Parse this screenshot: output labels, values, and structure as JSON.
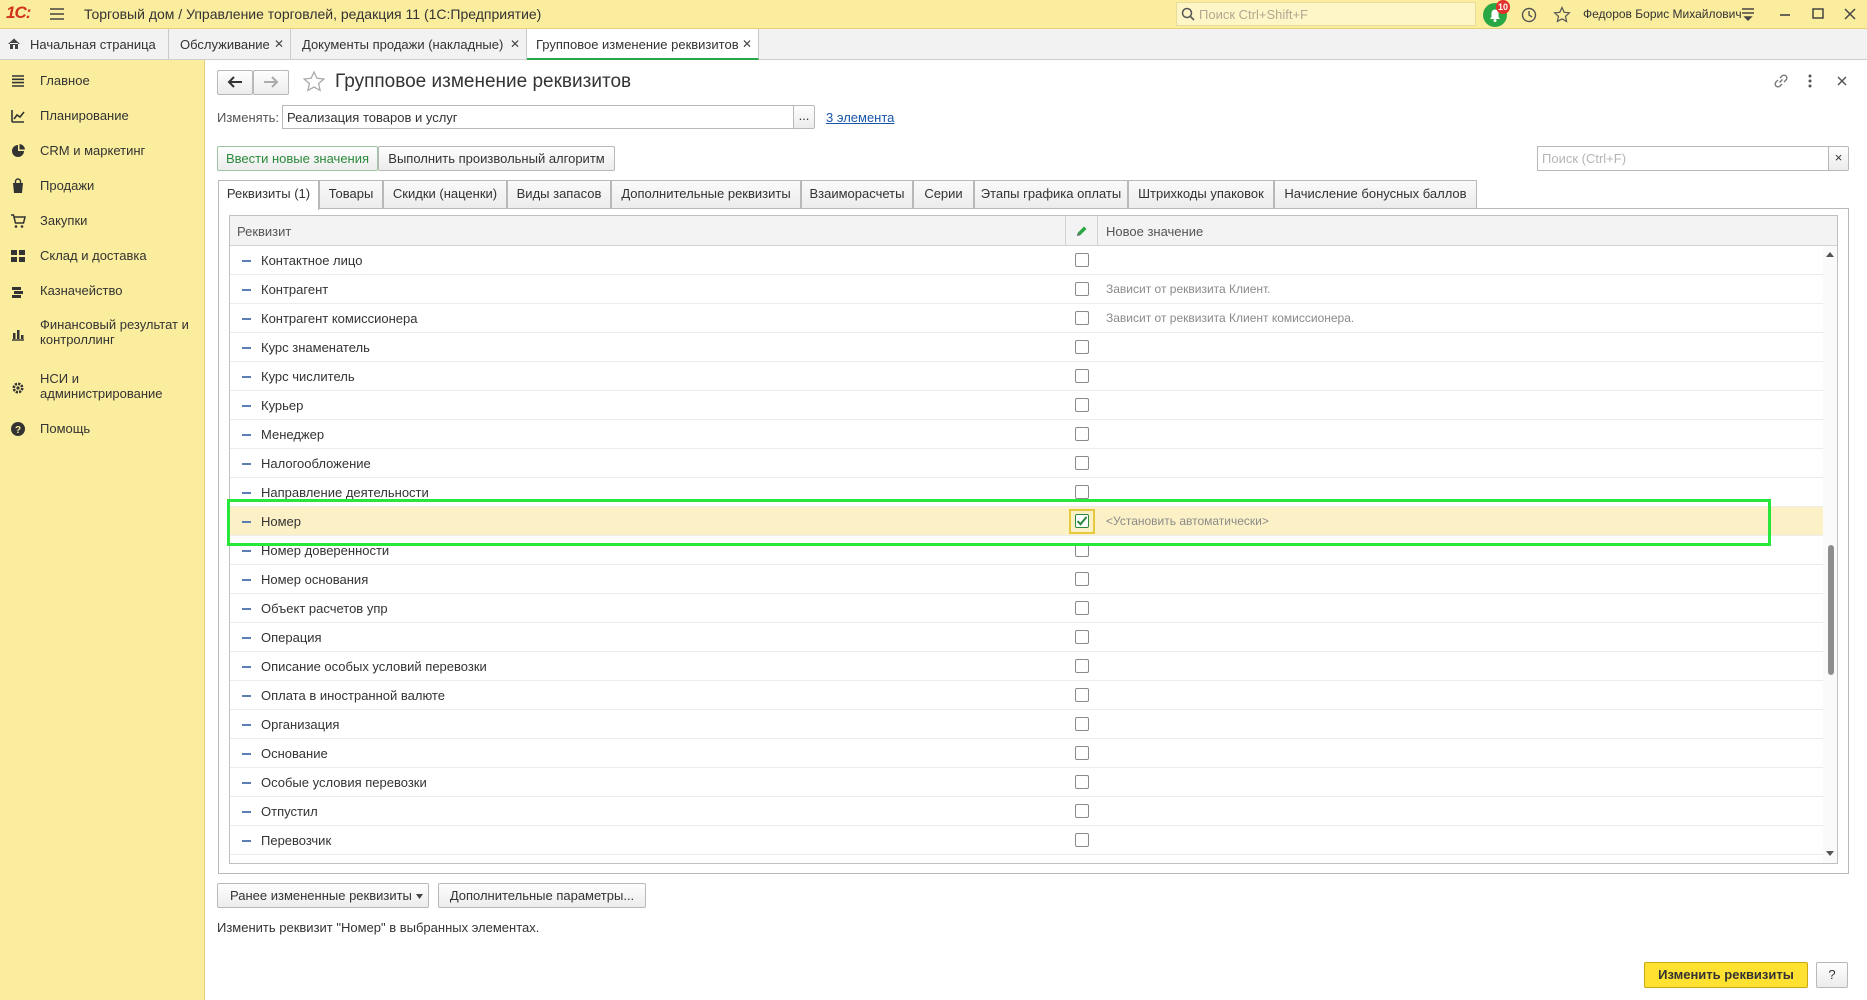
{
  "window": {
    "app_title": "Торговый дом / Управление торговлей, редакция 11  (1С:Предприятие)",
    "search_placeholder": "Поиск Ctrl+Shift+F",
    "notif_count": "10",
    "user_name": "Федоров Борис Михайлович"
  },
  "tabs": [
    {
      "label": "Начальная страница"
    },
    {
      "label": "Обслуживание"
    },
    {
      "label": "Документы продажи (накладные)"
    },
    {
      "label": "Групповое изменение реквизитов"
    }
  ],
  "sidebar": {
    "items": [
      {
        "label": "Главное",
        "icon": "menu-icon"
      },
      {
        "label": "Планирование",
        "icon": "planning-icon"
      },
      {
        "label": "CRM и маркетинг",
        "icon": "pie-icon"
      },
      {
        "label": "Продажи",
        "icon": "bag-icon"
      },
      {
        "label": "Закупки",
        "icon": "cart-icon"
      },
      {
        "label": "Склад и доставка",
        "icon": "grid-icon"
      },
      {
        "label": "Казначейство",
        "icon": "treasury-icon"
      },
      {
        "label": "Финансовый результат и контроллинг",
        "icon": "barchart-icon"
      },
      {
        "label": "НСИ и администрирование",
        "icon": "gear-icon"
      },
      {
        "label": "Помощь",
        "icon": "help-icon"
      }
    ]
  },
  "form": {
    "title": "Групповое изменение реквизитов",
    "change_label": "Изменять:",
    "object_type": "Реализация товаров и услуг",
    "select_button": "...",
    "elements_link": "3 элемента",
    "btn_new_values": "Ввести новые значения",
    "btn_algorithm": "Выполнить произвольный алгоритм",
    "search_placeholder": "Поиск (Ctrl+F)",
    "clear_search": "×"
  },
  "form_tabs": [
    "Реквизиты (1)",
    "Товары",
    "Скидки (наценки)",
    "Виды запасов",
    "Дополнительные реквизиты",
    "Взаиморасчеты",
    "Серии",
    "Этапы графика оплаты",
    "Штрихкоды упаковок",
    "Начисление бонусных баллов"
  ],
  "grid": {
    "col_attr": "Реквизит",
    "col_new_value": "Новое значение",
    "rows": [
      {
        "name": "Контактное лицо",
        "checked": false,
        "value": ""
      },
      {
        "name": "Контрагент",
        "checked": false,
        "value": "Зависит от реквизита Клиент."
      },
      {
        "name": "Контрагент комиссионера",
        "checked": false,
        "value": "Зависит от реквизита Клиент комиссионера."
      },
      {
        "name": "Курс знаменатель",
        "checked": false,
        "value": ""
      },
      {
        "name": "Курс числитель",
        "checked": false,
        "value": ""
      },
      {
        "name": "Курьер",
        "checked": false,
        "value": ""
      },
      {
        "name": "Менеджер",
        "checked": false,
        "value": ""
      },
      {
        "name": "Налогообложение",
        "checked": false,
        "value": ""
      },
      {
        "name": "Направление деятельности",
        "checked": false,
        "value": ""
      },
      {
        "name": "Номер",
        "checked": true,
        "value": "<Установить автоматически>"
      },
      {
        "name": "Номер доверенности",
        "checked": false,
        "value": ""
      },
      {
        "name": "Номер основания",
        "checked": false,
        "value": ""
      },
      {
        "name": "Объект расчетов упр",
        "checked": false,
        "value": ""
      },
      {
        "name": "Операция",
        "checked": false,
        "value": ""
      },
      {
        "name": "Описание особых условий перевозки",
        "checked": false,
        "value": ""
      },
      {
        "name": "Оплата в иностранной валюте",
        "checked": false,
        "value": ""
      },
      {
        "name": "Организация",
        "checked": false,
        "value": ""
      },
      {
        "name": "Основание",
        "checked": false,
        "value": ""
      },
      {
        "name": "Особые условия перевозки",
        "checked": false,
        "value": ""
      },
      {
        "name": "Отпустил",
        "checked": false,
        "value": ""
      },
      {
        "name": "Перевозчик",
        "checked": false,
        "value": ""
      }
    ]
  },
  "footer": {
    "btn_prev": "Ранее измененные реквизиты",
    "btn_params": "Дополнительные параметры...",
    "status": "Изменить реквизит \"Номер\" в выбранных элементах.",
    "btn_apply": "Изменить реквизиты",
    "btn_help": "?"
  },
  "colors": {
    "sidebar_bg": "#fbed9e",
    "accent_green": "#2aa745",
    "highlight_box": "#29e63a",
    "apply_button": "#ffe231"
  }
}
